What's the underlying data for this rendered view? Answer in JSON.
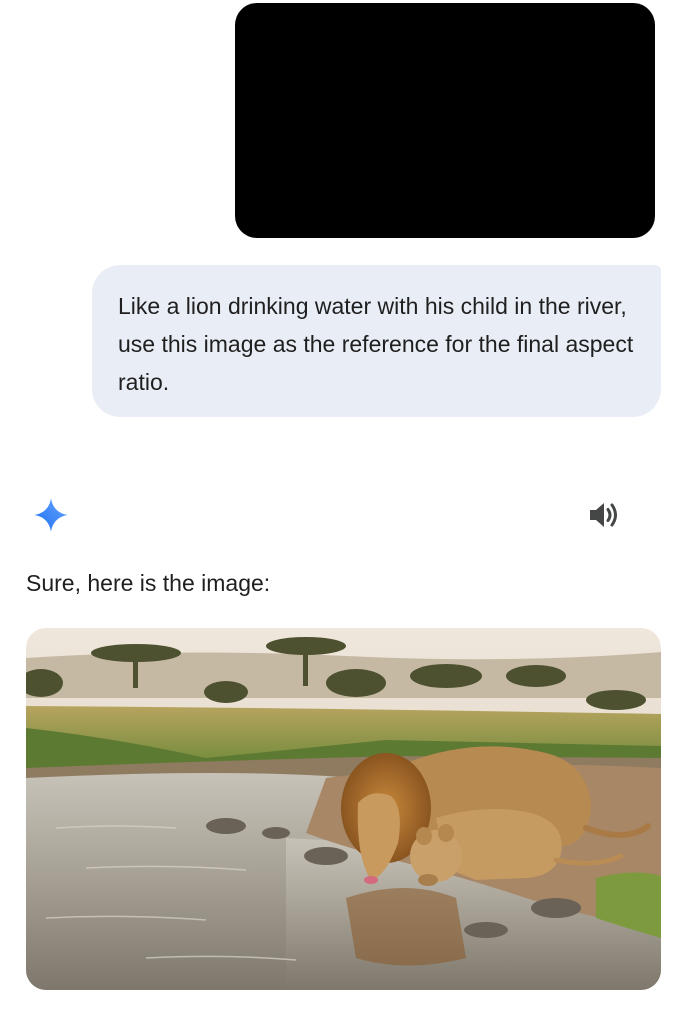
{
  "conversation": {
    "user_message": {
      "attachment": {
        "kind": "image",
        "fill_color": "#000000"
      },
      "text": "Like a lion drinking water with his child in the river, use this image as the reference for the final aspect ratio."
    },
    "assistant_message": {
      "avatar_icon": "gemini-sparkle-icon",
      "read_aloud_icon": "speaker-icon",
      "text": "Sure, here is the image:",
      "generated_image": {
        "subject": "lion and cub drinking from a river on the savanna"
      }
    }
  },
  "colors": {
    "user_bubble": "#e9eef6",
    "text": "#1f1f1f",
    "gemini_blue": "#4285f4",
    "icon_gray": "#444746"
  }
}
